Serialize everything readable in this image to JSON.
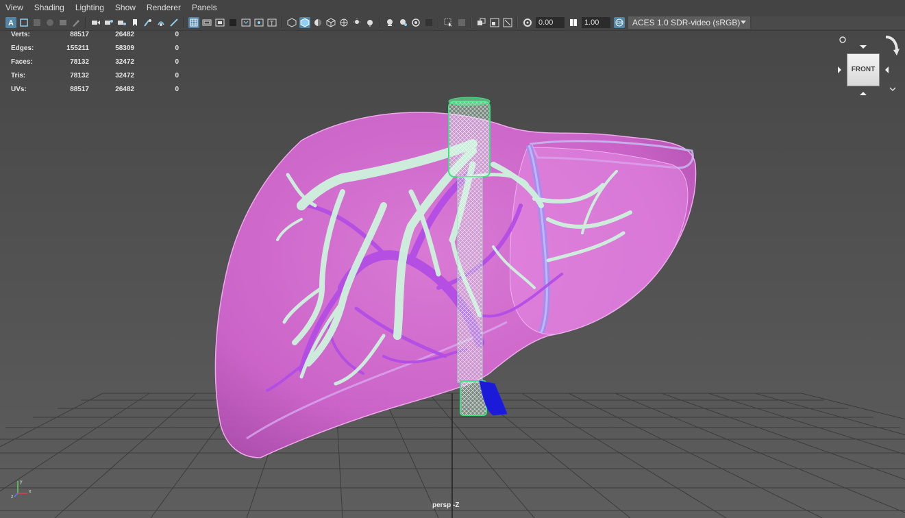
{
  "menu": [
    "View",
    "Shading",
    "Lighting",
    "Show",
    "Renderer",
    "Panels"
  ],
  "toolbar": {
    "icons": [
      "select-camera-icon",
      "camera-attributes-icon",
      "bookmarks-icon",
      "image-plane-icon",
      "2d-pan-zoom-icon",
      "grease-pencil-icon",
      "camera-icon",
      "film-gate-icon",
      "resolution-gate-icon",
      "gate-mask-icon",
      "field-chart-icon",
      "safe-action-icon",
      "safe-title-icon",
      "wireframe-icon",
      "smooth-shade-icon",
      "use-default-material-icon",
      "wireframe-on-shaded-icon",
      "xray-icon",
      "xray-active-icon",
      "xray-joints-icon",
      "lights-icon",
      "shadows-icon",
      "ambient-occlusion-icon",
      "motion-blur-icon",
      "multisample-aa-icon",
      "depth-of-field-icon",
      "isolate-select-icon",
      "grid-icon",
      "exposure-icon",
      "gamma-icon",
      "color-management-icon"
    ],
    "exposure_value": "0.00",
    "gamma_value": "1.00",
    "color_space": "ACES 1.0 SDR-video (sRGB)"
  },
  "hud": {
    "rows": [
      {
        "label": "Verts:",
        "v1": "88517",
        "v2": "26482",
        "v3": "0"
      },
      {
        "label": "Edges:",
        "v1": "155211",
        "v2": "58309",
        "v3": "0"
      },
      {
        "label": "Faces:",
        "v1": "78132",
        "v2": "32472",
        "v3": "0"
      },
      {
        "label": "Tris:",
        "v1": "78132",
        "v2": "32472",
        "v3": "0"
      },
      {
        "label": "UVs:",
        "v1": "88517",
        "v2": "26482",
        "v3": "0"
      }
    ]
  },
  "viewcube": {
    "face_label": "FRONT"
  },
  "camera_label": "persp -Z",
  "axis": {
    "x": "x",
    "y": "y",
    "z": "z"
  },
  "colors": {
    "liver": "#e070d0",
    "hepatic_vessels": "#c8f0d8",
    "portal_vessels": "#b040e0",
    "vena_cava": "#40e080",
    "accent": "#5285a6"
  }
}
